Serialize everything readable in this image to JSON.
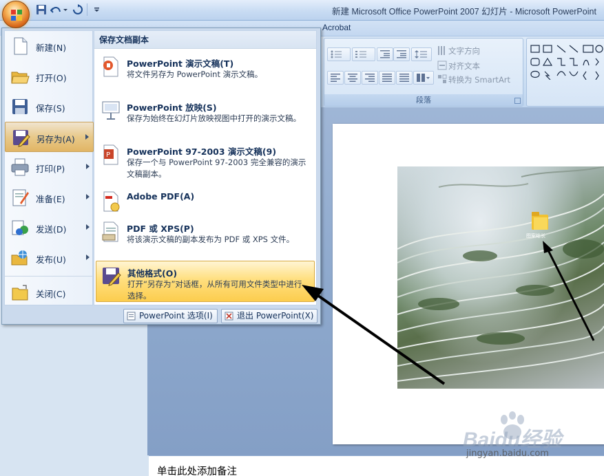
{
  "window": {
    "title": "新建 Microsoft Office PowerPoint 2007 幻灯片 - Microsoft PowerPoint"
  },
  "ribbon": {
    "tab_acrobat": "Acrobat",
    "text_direction": "文字方向",
    "align_text": "对齐文本",
    "convert_smartart": "转换为 SmartArt",
    "group_paragraph": "段落"
  },
  "office_menu": {
    "left_items": [
      {
        "label": "新建(N)",
        "icon": "new-document-icon"
      },
      {
        "label": "打开(O)",
        "icon": "open-folder-icon"
      },
      {
        "label": "保存(S)",
        "icon": "save-disk-icon"
      },
      {
        "label": "另存为(A)",
        "icon": "save-as-icon",
        "highlighted": true,
        "submenu": true
      },
      {
        "label": "打印(P)",
        "icon": "printer-icon",
        "submenu": true
      },
      {
        "label": "准备(E)",
        "icon": "prepare-icon",
        "submenu": true
      },
      {
        "label": "发送(D)",
        "icon": "send-icon",
        "submenu": true
      },
      {
        "label": "发布(U)",
        "icon": "publish-icon",
        "submenu": true
      },
      {
        "label": "关闭(C)",
        "icon": "close-folder-icon"
      }
    ],
    "submenu": {
      "header": "保存文档副本",
      "items": [
        {
          "title": "PowerPoint 演示文稿(T)",
          "desc": "将文件另存为 PowerPoint 演示文稿。",
          "icon": "pptx-icon"
        },
        {
          "title": "PowerPoint 放映(S)",
          "desc": "保存为始终在幻灯片放映视图中打开的演示文稿。",
          "icon": "ppsx-icon"
        },
        {
          "title": "PowerPoint 97-2003 演示文稿(9)",
          "desc": "保存一个与 PowerPoint 97-2003 完全兼容的演示文稿副本。",
          "icon": "ppt-icon"
        },
        {
          "title": "Adobe PDF(A)",
          "desc": "",
          "icon": "adobe-pdf-icon"
        },
        {
          "title": "PDF 或 XPS(P)",
          "desc": "将该演示文稿的副本发布为 PDF 或 XPS 文件。",
          "icon": "pdf-xps-icon"
        },
        {
          "title": "其他格式(O)",
          "desc": "打开“另存为”对话框，从所有可用文件类型中进行选择。",
          "icon": "other-formats-icon",
          "highlighted": true
        }
      ]
    },
    "footer": {
      "options_label": "PowerPoint 选项(I)",
      "exit_label": "退出 PowerPoint(X)"
    }
  },
  "slide": {
    "folder_label": "图案结长",
    "notes_placeholder": "单击此处添加备注"
  },
  "watermark": {
    "brand": "Baidu经验",
    "url": "jingyan.baidu.com"
  },
  "colors": {
    "menu_highlight": "#fcd061",
    "left_highlight": "#e6c07a",
    "ribbon_bg": "#c8dcf2",
    "workspace_bg": "#8ea9cd",
    "annotation_arrow": "#000000"
  }
}
